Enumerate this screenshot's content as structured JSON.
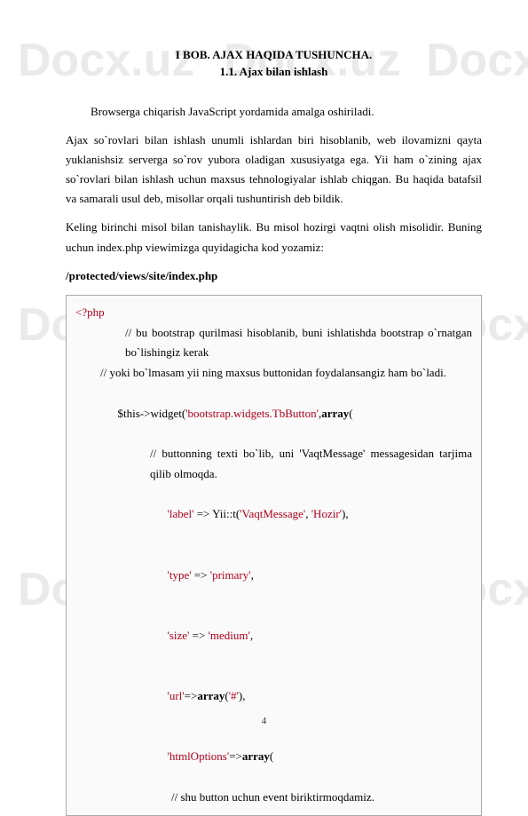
{
  "watermark": "Docx.uz",
  "heading": "I BOB. AJAX HAQIDA TUSHUNCHA.",
  "subheading": "1.1. Ajax bilan ishlash",
  "intro": "Browserga chiqarish JavaScript yordamida amalga oshiriladi.",
  "p1": "Ajax so`rovlari bilan ishlash unumli ishlardan biri hisoblanib, web ilovamizni qayta yuklanishsiz serverga so`rov yubora oladigan xususiyatga ega. Yii ham o`zining ajax so`rovlari bilan ishlash uchun maxsus tehnologiyalar ishlab chiqgan. Bu haqida batafsil va samarali usul deb, misollar orqali tushuntirish deb bildik.",
  "p2": "Keling birinchi misol bilan tanishaylik. Bu misol hozirgi vaqtni olish misolidir. Buning uchun index.php viewimizga quyidagicha kod yozamiz:",
  "path": "/protected/views/site/index.php",
  "code": {
    "l1": "<?php",
    "l2a": "// bu bootstrap qurilmasi hisoblanib, buni ishlatishda bootstrap o`rnatgan bo`lishingiz kerak",
    "l3": "// yoki bo`lmasam yii ning maxsus buttonidan foydalansangiz ham bo`ladi.",
    "l4a": "$this->widget(",
    "l4b": "'bootstrap.widgets.TbButton'",
    "l4c": ",",
    "l4d": "array",
    "l4e": "(",
    "l5": "// buttonning texti bo`lib, uni 'VaqtMessage' messagesidan tarjima qilib olmoqda.",
    "l6a": "'label'",
    "l6b": " => Yii::t(",
    "l6c": "'VaqtMessage'",
    "l6d": ", ",
    "l6e": "'Hozir'",
    "l6f": "),",
    "l7a": "'type'",
    "l7b": " => ",
    "l7c": "'primary'",
    "l7d": ",",
    "l8a": "'size'",
    "l8b": " => ",
    "l8c": "'medium'",
    "l8d": ",",
    "l9a": "'url'",
    "l9b": "=>",
    "l9c": "array",
    "l9d": "(",
    "l9e": "'#'",
    "l9f": "),",
    "l10a": "'htmlOptions'",
    "l10b": "=>",
    "l10c": "array",
    "l10d": "(",
    "l11": "// shu button uchun event biriktirmoqdamiz."
  },
  "pageNum": "4"
}
